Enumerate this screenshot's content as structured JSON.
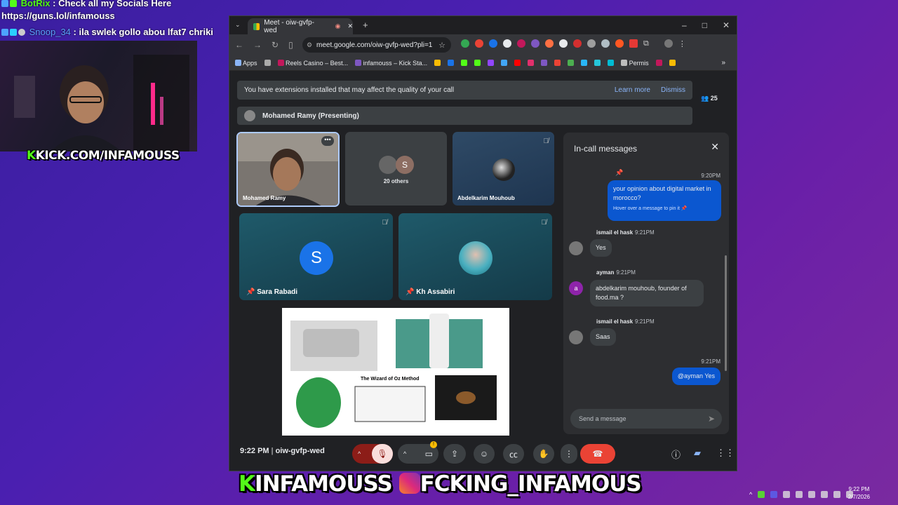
{
  "overlay": {
    "chat": [
      {
        "user": "BotRix",
        "text": "Check all my Socials Here"
      },
      {
        "user": "",
        "text": "https://guns.lol/infamouss"
      },
      {
        "user": "Snoop_34",
        "text": "ila swlek gollo abou lfat7 chriki"
      }
    ],
    "kick_tag_k": "K",
    "kick_tag": "KICK.COM/INFAMOUSS",
    "banner_k": "K",
    "banner_name": "INFAMOUSS",
    "banner_handle": "FCKING_INFAMOUS",
    "clock_time": "9:22 PM",
    "clock_date": "2/7/2026"
  },
  "browser": {
    "tab_title": "Meet - oiw-gvfp-wed",
    "url": "meet.google.com/oiw-gvfp-wed?pli=1",
    "bookmarks": [
      "Apps",
      "Reels Casino – Best...",
      "infamouss – Kick Sta...",
      "Permis"
    ],
    "window_controls": {
      "minimize": "–",
      "maximize": "□",
      "close": "✕"
    }
  },
  "meet": {
    "ext_warning": "You have extensions installed that may affect the quality of your call",
    "learn_more": "Learn more",
    "dismiss": "Dismiss",
    "participant_count": "25",
    "presenting": "Mohamed Ramy (Presenting)",
    "tiles": {
      "self": "Mohamed Ramy",
      "others_label": "20 others",
      "others_initial": "S",
      "abdelkarim": "Abdelkarim Mouhoub",
      "sara": "Sara Rabadi",
      "sara_initial": "S",
      "kh": "Kh Assabiri"
    },
    "slide": {
      "title": "The Wizard of Oz Method"
    },
    "chat": {
      "title": "In-call messages",
      "messages": [
        {
          "time": "9:20PM",
          "text": "your opinion about digital market in morocco?",
          "hint": "Hover over a message to pin it"
        },
        {
          "sender": "ismail el hask",
          "time": "9:21PM",
          "text": "Yes"
        },
        {
          "sender": "ayman",
          "time": "9:21PM",
          "initial": "a",
          "text": "abdelkarim mouhoub, founder of food.ma ?"
        },
        {
          "sender": "ismail el hask",
          "time": "9:21PM",
          "text": "Saas"
        },
        {
          "time": "9:21PM",
          "text": "@ayman Yes"
        }
      ],
      "input_placeholder": "Send a message"
    },
    "toolbar": {
      "time": "9:22 PM",
      "separator": "|",
      "meeting_code": "oiw-gvfp-wed"
    }
  },
  "colors": {
    "accent_blue": "#8ab4f8",
    "own_bubble": "#0b57d0",
    "end_call": "#ea4335",
    "kick_green": "#53fc18"
  }
}
